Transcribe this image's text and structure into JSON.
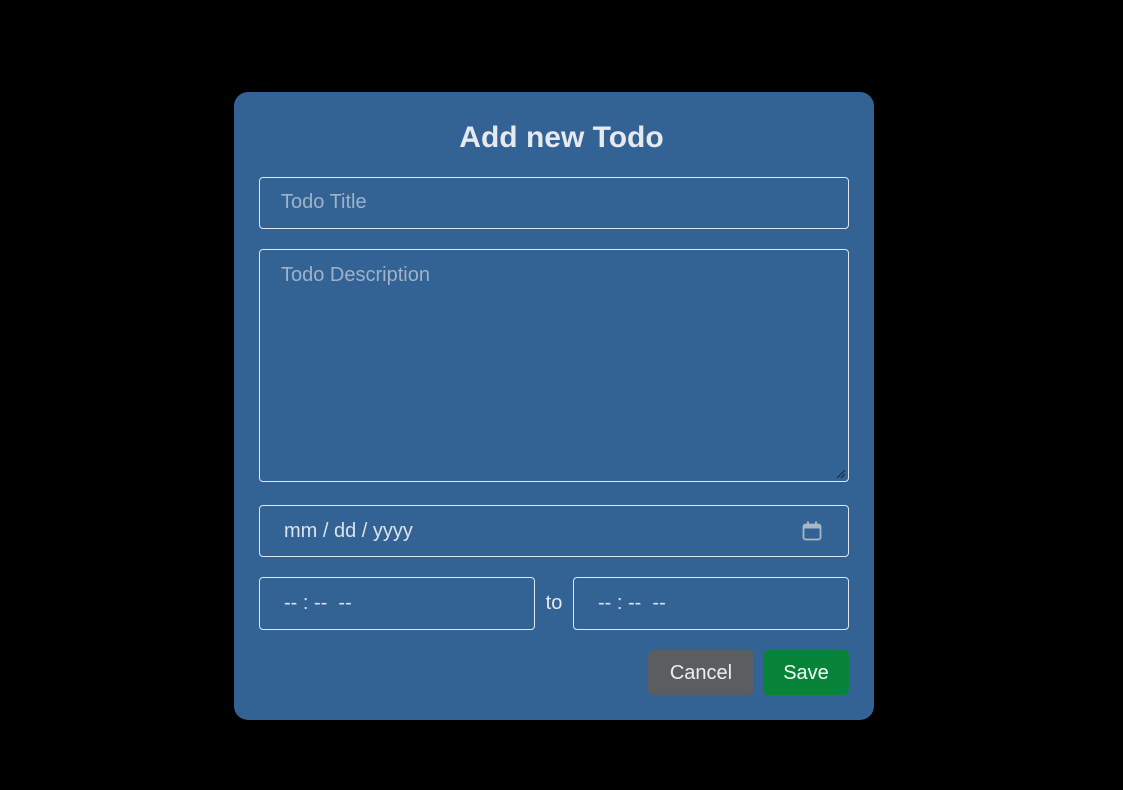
{
  "modal": {
    "title": "Add new Todo"
  },
  "form": {
    "title_placeholder": "Todo Title",
    "description_placeholder": "Todo Description",
    "date_placeholder": "mm / dd / yyyy",
    "start_time_placeholder": "-- : --  --",
    "separator_label": "to",
    "end_time_placeholder": "-- : --  --"
  },
  "actions": {
    "cancel_label": "Cancel",
    "save_label": "Save"
  },
  "icons": {
    "calendar": "calendar-icon",
    "resize": "resize-handle-icon"
  },
  "colors": {
    "modal_background": "#336294",
    "cancel_button": "#5b5e61",
    "save_button": "#07843a"
  }
}
